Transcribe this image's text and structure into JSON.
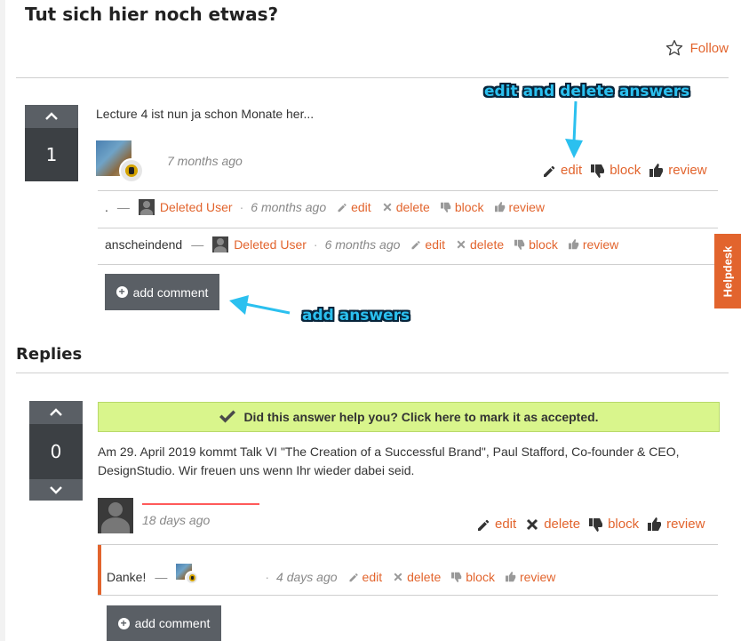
{
  "page_title": "Tut sich hier noch etwas?",
  "follow_label": "Follow",
  "question": {
    "votes": "1",
    "text": "Lecture 4 ist nun ja schon Monate her...",
    "time": "7 months ago",
    "actions": {
      "edit": "edit",
      "block": "block",
      "review": "review"
    },
    "comments": [
      {
        "text": ".",
        "user": "Deleted User",
        "time": "6 months ago",
        "edit": "edit",
        "delete": "delete",
        "block": "block",
        "review": "review"
      },
      {
        "text": "anscheindend",
        "user": "Deleted User",
        "time": "6 months ago",
        "edit": "edit",
        "delete": "delete",
        "block": "block",
        "review": "review"
      }
    ],
    "add_comment": "add comment"
  },
  "annotations": {
    "edit_delete": "edit and delete answers",
    "add_answers": "add answers"
  },
  "helpdesk": "Helpdesk",
  "replies_heading": "Replies",
  "answer": {
    "votes": "0",
    "accept_banner": "Did this answer help you? Click here to mark it as accepted.",
    "text": "Am 29. April 2019 kommt Talk VI \"The Creation of a Successful Brand\", Paul Stafford, Co-founder & CEO, DesignStudio. Wir freuen uns wenn Ihr wieder dabei seid.",
    "time": "18 days ago",
    "actions": {
      "edit": "edit",
      "delete": "delete",
      "block": "block",
      "review": "review"
    },
    "comment": {
      "text": "Danke!",
      "time": "4 days ago",
      "edit": "edit",
      "delete": "delete",
      "block": "block",
      "review": "review"
    },
    "add_comment": "add comment"
  },
  "colors": {
    "accent": "#e2642d",
    "vote_bg": "#3c4044",
    "accept_bg": "#d9f58c",
    "annotation": "#2bc0ef"
  }
}
